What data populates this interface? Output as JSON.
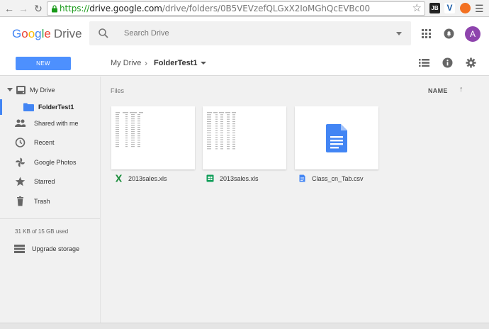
{
  "browser": {
    "url_scheme": "https://",
    "url_host": "drive.google.com",
    "url_path": "/drive/folders/0B5VEVzefQLGxX2IoMGhQcEVBc00",
    "extensions": [
      "JB",
      "V",
      ""
    ],
    "icons": [
      "back-icon",
      "forward-icon",
      "reload-icon",
      "lock-icon",
      "star-icon",
      "menu-icon"
    ]
  },
  "header": {
    "logo_letters": [
      "G",
      "o",
      "o",
      "g",
      "l",
      "e"
    ],
    "logo_product": "Drive",
    "search_placeholder": "Search Drive",
    "avatar_letter": "A",
    "avatar_color": "#8e44ad",
    "icons": [
      "search-icon",
      "apps-icon",
      "notifications-icon"
    ]
  },
  "toolbar": {
    "new_label": "NEW",
    "breadcrumb_root": "My Drive",
    "breadcrumb_separator": "›",
    "breadcrumb_current": "FolderTest1",
    "icons": [
      "list-view-icon",
      "info-icon",
      "settings-icon"
    ]
  },
  "sidebar": {
    "my_drive": "My Drive",
    "selected_folder": "FolderTest1",
    "items": [
      {
        "label": "Shared with me",
        "icon": "shared-icon"
      },
      {
        "label": "Recent",
        "icon": "clock-icon"
      },
      {
        "label": "Google Photos",
        "icon": "photos-icon"
      },
      {
        "label": "Starred",
        "icon": "star-icon"
      },
      {
        "label": "Trash",
        "icon": "trash-icon"
      }
    ],
    "storage_text": "31 KB of 15 GB used",
    "upgrade_label": "Upgrade storage"
  },
  "main": {
    "section_title": "Files",
    "sort_label": "NAME",
    "sort_arrow": "↑",
    "files": [
      {
        "name": "2013sales.xls",
        "icon": "excel-icon",
        "color": "#1e8e3e"
      },
      {
        "name": "2013sales.xls",
        "icon": "sheets-icon",
        "color": "#0f9d58"
      },
      {
        "name": "Class_cn_Tab.csv",
        "icon": "docs-icon",
        "color": "#4285f4"
      }
    ]
  }
}
